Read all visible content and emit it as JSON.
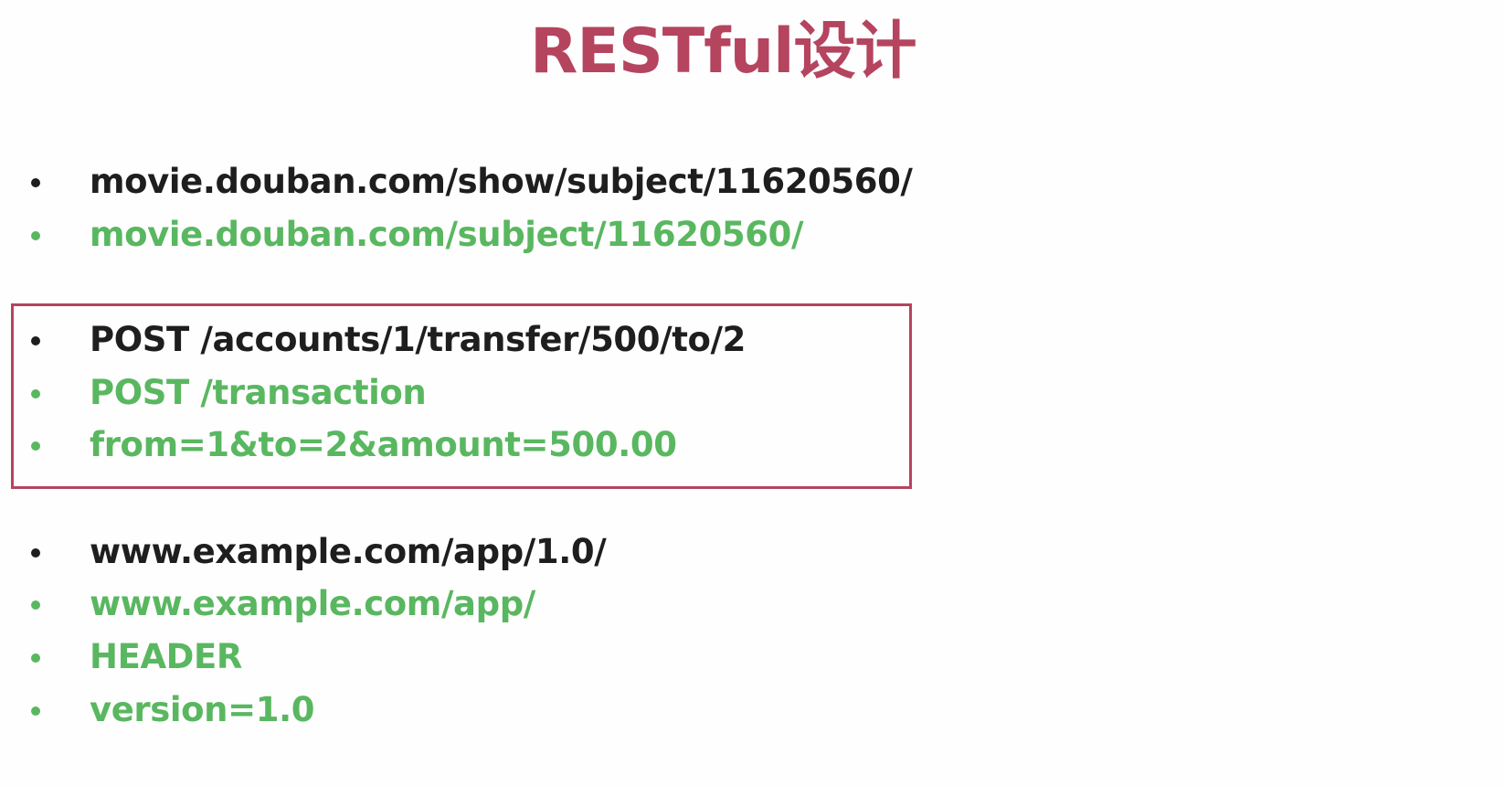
{
  "title": "RESTful设计",
  "groups": [
    {
      "items": [
        {
          "text": "movie.douban.com/show/subject/11620560/",
          "style": "black"
        },
        {
          "text": "movie.douban.com/subject/11620560/",
          "style": "green"
        }
      ]
    },
    {
      "highlighted": true,
      "items": [
        {
          "text": "POST /accounts/1/transfer/500/to/2",
          "style": "black"
        },
        {
          "text": "POST /transaction",
          "style": "green"
        },
        {
          "text": "from=1&to=2&amount=500.00",
          "style": "green"
        }
      ]
    },
    {
      "items": [
        {
          "text": "www.example.com/app/1.0/",
          "style": "black"
        },
        {
          "text": "www.example.com/app/",
          "style": "green"
        },
        {
          "text": "HEADER",
          "style": "green"
        },
        {
          "text": "version=1.0",
          "style": "green"
        }
      ]
    }
  ],
  "colors": {
    "title": "#b5445f",
    "text_dark": "#1e1e1e",
    "text_green": "#59b760",
    "box_border": "#b5445f"
  }
}
